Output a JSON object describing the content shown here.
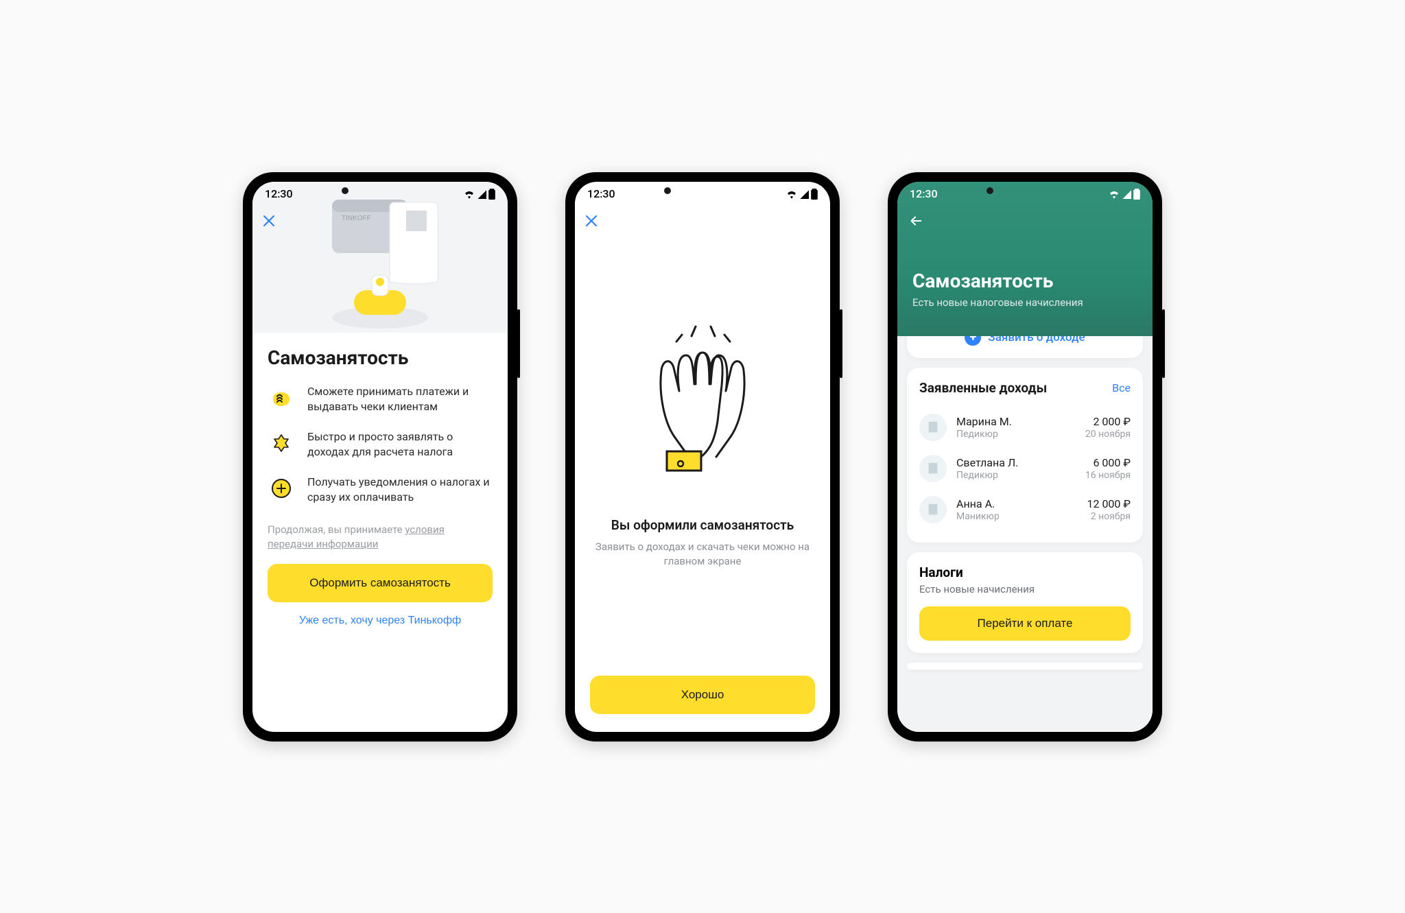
{
  "status": {
    "time": "12:30"
  },
  "screen1": {
    "title": "Самозанятость",
    "hero_brand": "TINKOFF",
    "features": [
      "Сможете принимать платежи и выдавать чеки клиентам",
      "Быстро и просто заявлять о доходах для расчета налога",
      "Получать уведомления о налогах и сразу их оплачивать"
    ],
    "disclaimer_prefix": "Продолжая, вы принимаете ",
    "disclaimer_link": "условия передачи информации",
    "primary_cta": "Оформить самозанятость",
    "secondary_cta": "Уже есть, хочу через Тинькофф"
  },
  "screen2": {
    "title": "Вы оформили самозанятость",
    "subtitle": "Заявить о доходах и скачать чеки можно на главном экране",
    "cta": "Хорошо"
  },
  "screen3": {
    "title": "Самозанятость",
    "subtitle": "Есть новые налоговые начисления",
    "declare_cta": "Заявить о доходе",
    "incomes_title": "Заявленные доходы",
    "incomes_all": "Все",
    "incomes": [
      {
        "name": "Марина М.",
        "service": "Педикюр",
        "amount": "2 000 ₽",
        "date": "20 ноября"
      },
      {
        "name": "Светлана Л.",
        "service": "Педикюр",
        "amount": "6 000 ₽",
        "date": "16 ноября"
      },
      {
        "name": "Анна А.",
        "service": "Маникюр",
        "amount": "12 000 ₽",
        "date": "2 ноября"
      }
    ],
    "taxes_title": "Налоги",
    "taxes_subtitle": "Есть новые начисления",
    "taxes_cta": "Перейти к оплате"
  }
}
